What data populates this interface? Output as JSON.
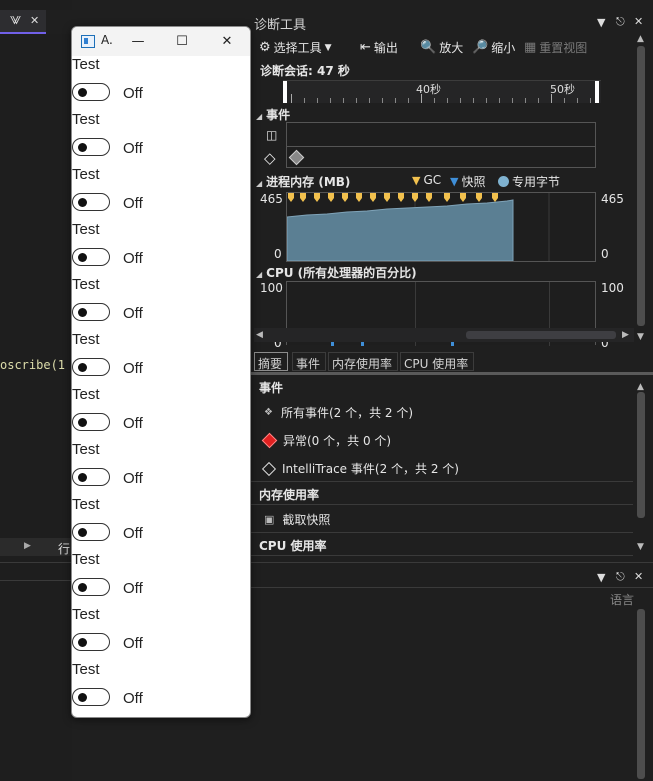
{
  "editor": {
    "tab_pin": "⨈",
    "tab_close": "✕",
    "code_fragment": "oscribe(1 =",
    "status_label": "行"
  },
  "app": {
    "title": "A.",
    "minimize": "—",
    "maximize": "☐",
    "close": "✕",
    "rows": [
      {
        "label": "Test",
        "state": "Off"
      },
      {
        "label": "Test",
        "state": "Off"
      },
      {
        "label": "Test",
        "state": "Off"
      },
      {
        "label": "Test",
        "state": "Off"
      },
      {
        "label": "Test",
        "state": "Off"
      },
      {
        "label": "Test",
        "state": "Off"
      },
      {
        "label": "Test",
        "state": "Off"
      },
      {
        "label": "Test",
        "state": "Off"
      },
      {
        "label": "Test",
        "state": "Off"
      },
      {
        "label": "Test",
        "state": "Off"
      },
      {
        "label": "Test",
        "state": "Off"
      },
      {
        "label": "Test",
        "state": "Off"
      }
    ]
  },
  "diag": {
    "title": "诊断工具",
    "toolbar": {
      "select_tools": "选择工具",
      "output": "输出",
      "zoom_in": "放大",
      "zoom_out": "缩小",
      "reset_view": "重置视图"
    },
    "session": "诊断会话: 47 秒",
    "ruler": {
      "label_40": "40秒",
      "label_50": "50秒"
    },
    "events_header": "事件",
    "memory_header": "进程内存 (MB)",
    "legend": {
      "gc": "GC",
      "snapshot": "快照",
      "private_bytes": "专用字节"
    },
    "memory_axis": {
      "max_left": "465",
      "min_left": "0",
      "max_right": "465",
      "min_right": "0"
    },
    "cpu_header": "CPU (所有处理器的百分比)",
    "cpu_axis": {
      "max_left": "100",
      "min_left": "0",
      "max_right": "100",
      "min_right": "0"
    },
    "tabs": [
      "摘要",
      "事件",
      "内存使用率",
      "CPU 使用率"
    ],
    "summary": {
      "events_header": "事件",
      "all_events": "所有事件(2 个，共 2 个)",
      "exceptions": "异常(0 个，共 0 个)",
      "intellitrace": "IntelliTrace 事件(2 个，共 2 个)",
      "memory_header": "内存使用率",
      "take_snapshot": "截取快照",
      "cpu_header": "CPU 使用率"
    },
    "colors": {
      "memory_fill": "#5b7f93",
      "gc_marker": "#f2c14e",
      "snapshot_marker": "#3f8fd8",
      "exception_red": "#e02020"
    }
  },
  "lower_pane": {
    "language_label": "语言"
  }
}
